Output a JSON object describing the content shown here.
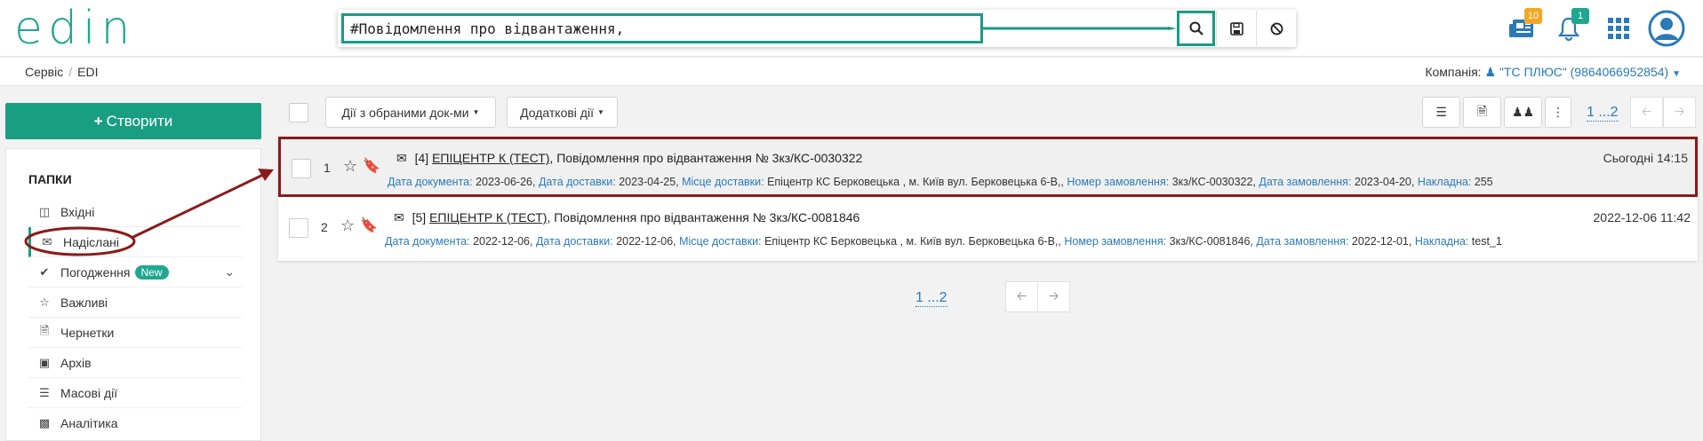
{
  "header": {
    "logo": "edin",
    "search": {
      "value": "#Повідомлення про відвантаження,"
    },
    "news_badge": "10",
    "notif_badge": "1"
  },
  "breadcrumb": {
    "items": [
      "Сервіс",
      "EDI"
    ]
  },
  "company": {
    "label": "Компанія:",
    "value": "\"ТС ПЛЮС\" (9864066952854)"
  },
  "sidebar": {
    "create_label": "Створити",
    "folders_title": "ПАПКИ",
    "items": [
      {
        "label": "Вхідні",
        "icon": "inbox-icon"
      },
      {
        "label": "Надіслані",
        "icon": "envelope-icon"
      },
      {
        "label": "Погодження",
        "icon": "check-icon",
        "badge": "New"
      },
      {
        "label": "Важливі",
        "icon": "star-icon"
      },
      {
        "label": "Чернетки",
        "icon": "file-icon"
      },
      {
        "label": "Архів",
        "icon": "archive-icon"
      },
      {
        "label": "Масові дії",
        "icon": "bulk-icon"
      },
      {
        "label": "Аналітика",
        "icon": "chart-icon"
      }
    ]
  },
  "toolbar": {
    "actions_label": "Дії з обраними док-ми",
    "extra_label": "Додаткові дії",
    "pager": "1 ...2"
  },
  "documents": [
    {
      "num": "1",
      "title_prefix": "[4]",
      "partner": "ЕПІЦЕНТР К (ТЕСТ)",
      "title": ", Повідомлення про відвантаження № 3кз/КС-0030322",
      "datetime": "Сьогодні 14:15",
      "doc_date_k": "Дата документа:",
      "doc_date": "2023-06-26,",
      "del_date_k": "Дата доставки:",
      "del_date": "2023-04-25,",
      "place_k": "Місце доставки:",
      "place": "Епіцентр КС Берковецька , м. Київ вул. Берковецька 6-В,,",
      "order_k": "Номер замовлення:",
      "order": "3кз/КС-0030322,",
      "order_date_k": "Дата замовлення:",
      "order_date": "2023-04-20,",
      "invoice_k": "Накладна:",
      "invoice": "255"
    },
    {
      "num": "2",
      "title_prefix": "[5]",
      "partner": "ЕПІЦЕНТР К (ТЕСТ)",
      "title": ", Повідомлення про відвантаження № 3кз/КС-0081846",
      "datetime": "2022-12-06 11:42",
      "doc_date_k": "Дата документа:",
      "doc_date": "2022-12-06,",
      "del_date_k": "Дата доставки:",
      "del_date": "2022-12-06,",
      "place_k": "Місце доставки:",
      "place": "Епіцентр КС Берковецька , м. Київ вул. Берковецька 6-В,,",
      "order_k": "Номер замовлення:",
      "order": "3кз/КС-0081846,",
      "order_date_k": "Дата замовлення:",
      "order_date": "2022-12-01,",
      "invoice_k": "Накладна:",
      "invoice": "test_1"
    }
  ],
  "pager_bottom": "1 ...2",
  "colors": {
    "accent": "#1a9e82",
    "link": "#2a7ab8",
    "annotation": "#8c1a1a"
  }
}
